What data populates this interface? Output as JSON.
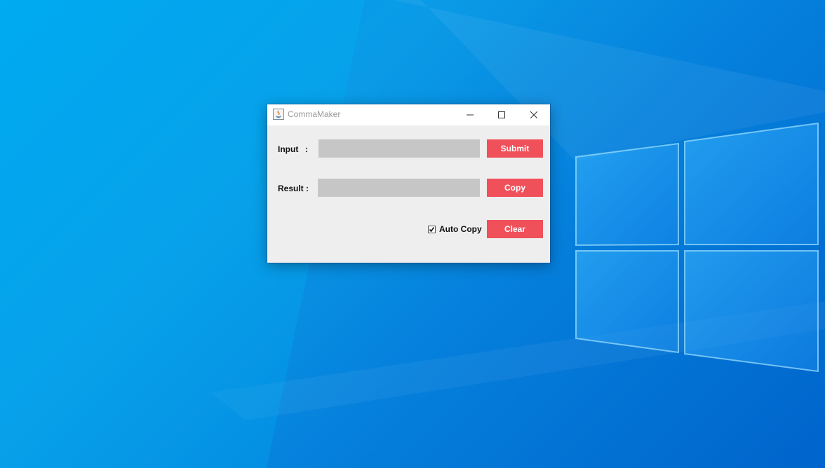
{
  "window": {
    "title": "CommaMaker",
    "app_icon": "java-cup-icon",
    "controls": [
      "minimize-icon",
      "maximize-icon",
      "close-icon"
    ]
  },
  "form": {
    "input_label": "Input",
    "input_colon": ":",
    "input_value": "",
    "result_label": "Result :",
    "result_value": "",
    "submit_label": "Submit",
    "copy_label": "Copy",
    "clear_label": "Clear",
    "auto_copy_label": "Auto Copy",
    "auto_copy_checked": true
  },
  "colors": {
    "button_bg": "#f0505a",
    "field_bg": "#c6c6c6",
    "window_bg": "#eeeeee",
    "desktop_bg": "#0a9ae6"
  }
}
